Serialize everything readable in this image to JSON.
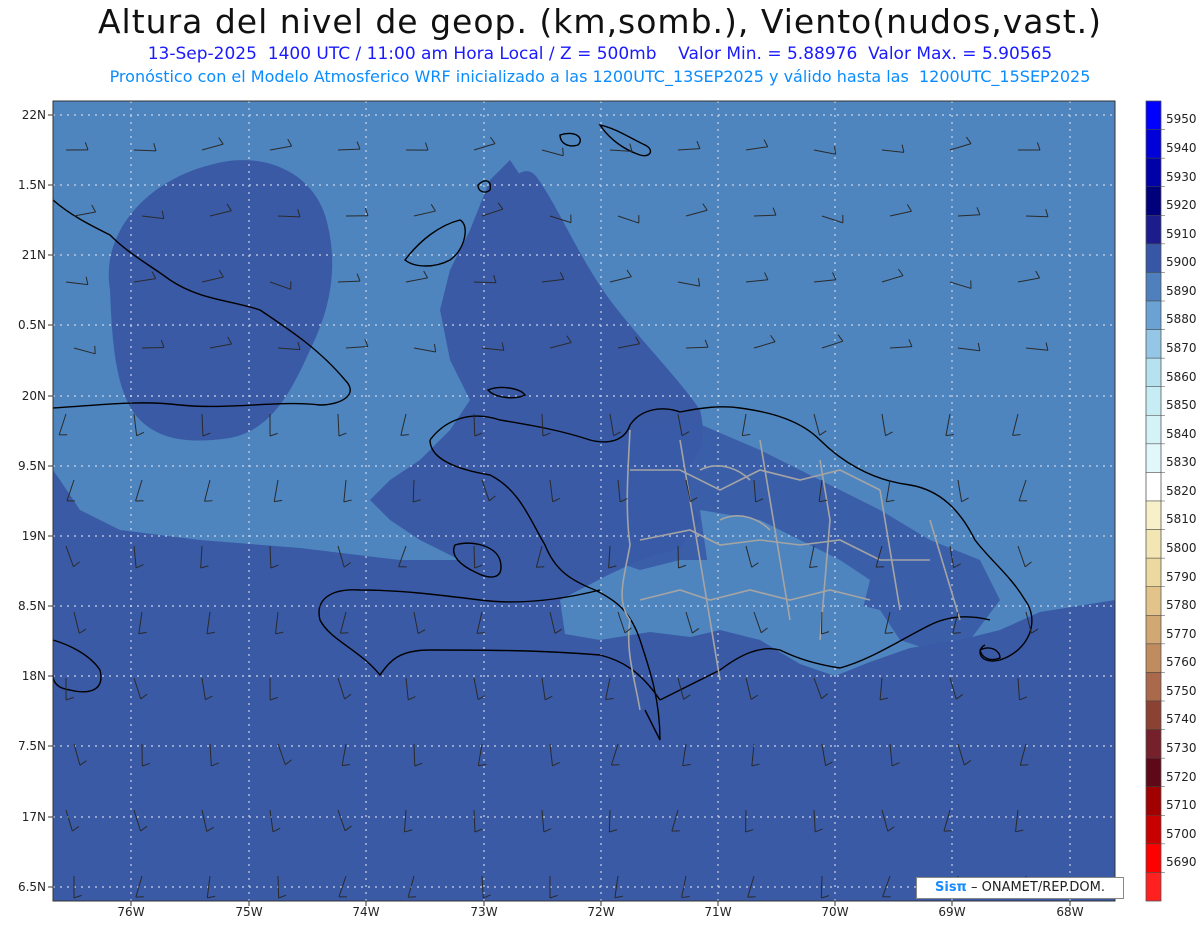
{
  "header": {
    "title": "Altura del nivel de geop. (km,somb.), Viento(nudos,vast.)",
    "subtitle1": "13-Sep-2025  1400 UTC / 11:00 am Hora Local / Z = 500mb    Valor Min. = 5.88976  Valor Max. = 5.90565",
    "subtitle2": "Pronóstico con el Modelo Atmosferico WRF inicializado a las 1200UTC_13SEP2025 y válido hasta las  1200UTC_15SEP2025"
  },
  "axes": {
    "lat_labels": [
      "22N",
      "1.5N",
      "21N",
      "0.5N",
      "20N",
      "9.5N",
      "19N",
      "8.5N",
      "18N",
      "7.5N",
      "17N",
      "6.5N"
    ],
    "lon_labels": [
      "76W",
      "75W",
      "74W",
      "73W",
      "72W",
      "71W",
      "70W",
      "69W",
      "68W"
    ]
  },
  "colorbar": {
    "levels": [
      "5950",
      "5940",
      "5930",
      "5920",
      "5910",
      "5900",
      "5890",
      "5880",
      "5870",
      "5860",
      "5850",
      "5840",
      "5830",
      "5820",
      "5810",
      "5800",
      "5790",
      "5780",
      "5770",
      "5760",
      "5750",
      "5740",
      "5730",
      "5720",
      "5710",
      "5700",
      "5690"
    ],
    "colors": [
      "#0000ff",
      "#0000d8",
      "#0000a8",
      "#00007a",
      "#1c1c8c",
      "#3757a6",
      "#4d80bc",
      "#6aa2d3",
      "#95c6e6",
      "#b6e2f0",
      "#c8ecf4",
      "#d5f2f7",
      "#e2f7fa",
      "#ffffff",
      "#f7f0c9",
      "#f2e6b4",
      "#ecd9a0",
      "#e2c48a",
      "#d1a873",
      "#c08c5f",
      "#a9694a",
      "#8c4233",
      "#76202b",
      "#5e0818",
      "#a00000",
      "#c80000",
      "#ff0000",
      "#ff2020"
    ],
    "colors_note_field": "background shading"
  },
  "field": {
    "background_color": "#3a5aa6",
    "ridge_color": "#4e85bf",
    "coast_color": "#000000",
    "border_color": "#9e9e9e"
  },
  "credit": {
    "logo": "Sisπ",
    "text": " –  ONAMET/REP.DOM."
  }
}
